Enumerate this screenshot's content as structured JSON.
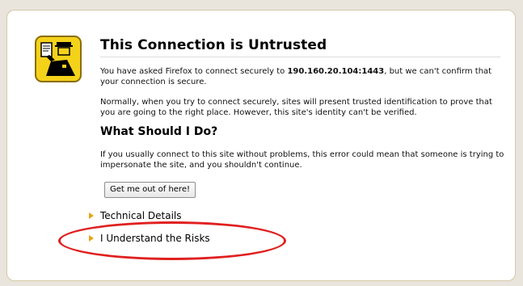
{
  "error_page": {
    "title": "This Connection is Untrusted",
    "intro_before_host": "You have asked Firefox to connect securely to ",
    "host": "190.160.20.104:1443",
    "intro_after_host": ", but we can't confirm that your connection is secure.",
    "explanation": "Normally, when you try to connect securely, sites will present trusted identification to prove that you are going to the right place. However, this site's identity can't be verified.",
    "subheading": "What Should I Do?",
    "advice": "If you usually connect to this site without problems, this error could mean that someone is trying to impersonate the site, and you shouldn't continue.",
    "escape_button_label": "Get me out of here!",
    "technical_details_label": "Technical Details",
    "understand_risks_label": "I Understand the Risks"
  },
  "colors": {
    "icon_yellow": "#f5d21a",
    "expander_arrow": "#e8a317",
    "annotation_ring": "#e02020",
    "panel_border": "#d6c9a6"
  },
  "icons": {
    "warning": "security-officer-icon",
    "expander": "expander-arrow-icon"
  }
}
